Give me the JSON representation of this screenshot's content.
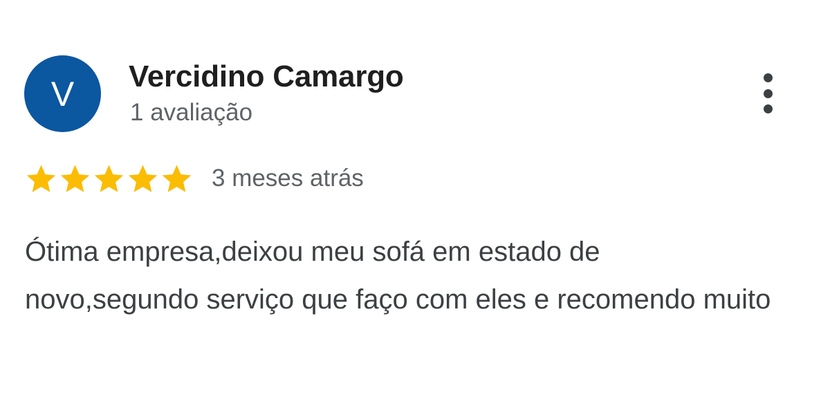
{
  "review": {
    "avatar_letter": "V",
    "avatar_color": "#0b57a0",
    "reviewer_name": "Vercidino Camargo",
    "review_count": "1 avaliação",
    "rating": 5,
    "rating_max": 5,
    "star_color": "#fbbc04",
    "date": "3 meses atrás",
    "text": "Ótima empresa,deixou meu sofá em estado de novo,segundo serviço que faço com eles e recomendo muito"
  },
  "icons": {
    "more": "more-vert-icon",
    "star": "star-icon"
  }
}
